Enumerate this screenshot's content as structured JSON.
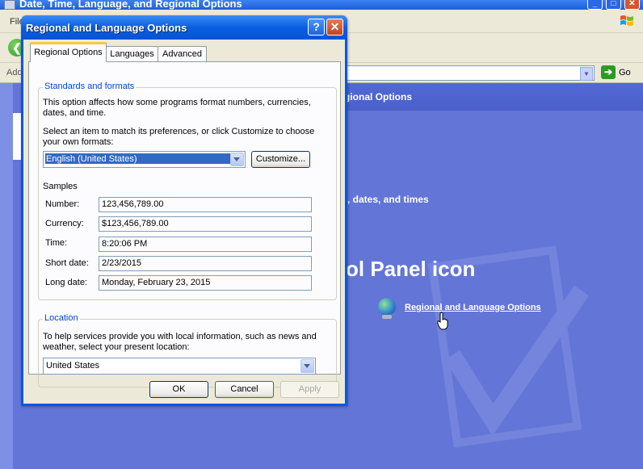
{
  "background_window": {
    "title": "Date, Time, Language, and Regional Options",
    "menu_file": "File",
    "address_label": "Address",
    "go_label": "Go",
    "header_text": "gional Options",
    "category_text": ", dates, and times",
    "panel_heading": "ol Panel icon",
    "regional_link": "Regional and Language Options"
  },
  "dialog": {
    "title": "Regional and Language Options",
    "help_label": "?",
    "close_label": "✕",
    "tabs": [
      {
        "label": "Regional Options",
        "active": true
      },
      {
        "label": "Languages",
        "active": false
      },
      {
        "label": "Advanced",
        "active": false
      }
    ],
    "standards": {
      "legend": "Standards and formats",
      "description": "This option affects how some programs format numbers, currencies, dates, and time.",
      "select_prompt": "Select an item to match its preferences, or click Customize to choose your own formats:",
      "selected_format": "English (United States)",
      "customize_label": "Customize...",
      "samples_label": "Samples",
      "samples": [
        {
          "label": "Number:",
          "value": "123,456,789.00"
        },
        {
          "label": "Currency:",
          "value": "$123,456,789.00"
        },
        {
          "label": "Time:",
          "value": "8:20:06 PM"
        },
        {
          "label": "Short date:",
          "value": "2/23/2015"
        },
        {
          "label": "Long date:",
          "value": "Monday, February 23, 2015"
        }
      ]
    },
    "location": {
      "legend": "Location",
      "description": "To help services provide you with local information, such as news and weather, select your present location:",
      "selected_location": "United States"
    },
    "buttons": {
      "ok": "OK",
      "cancel": "Cancel",
      "apply": "Apply"
    }
  },
  "colors": {
    "desktop_blue": "#6375d6",
    "title_blue": "#0a5fe0",
    "selection_blue": "#316ac5",
    "legend_blue": "#0046d5",
    "close_red": "#c8401c",
    "dialog_face": "#ece9d8"
  }
}
